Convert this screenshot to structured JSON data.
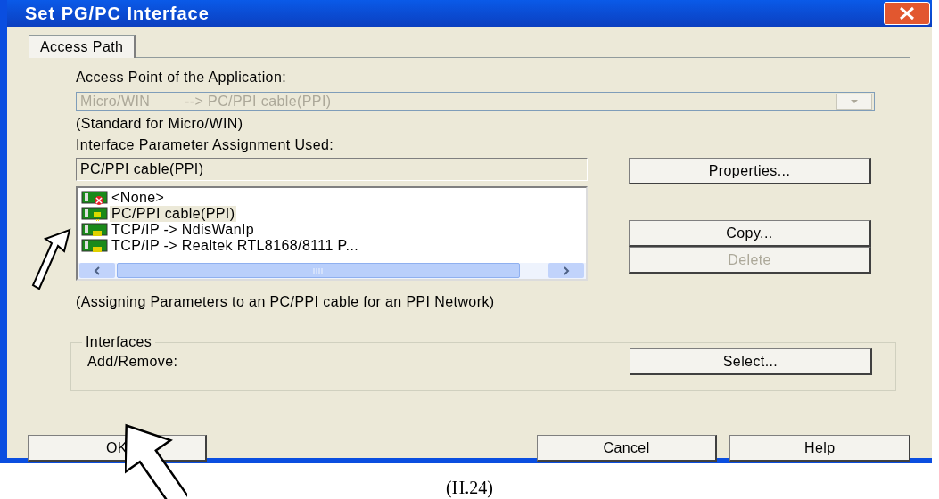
{
  "window": {
    "title": "Set PG/PC Interface"
  },
  "tabs": [
    {
      "label": "Access Path",
      "selected": true
    }
  ],
  "access_point": {
    "label": "Access Point of the Application:",
    "value": "Micro/WIN        --> PC/PPI cable(PPI)",
    "disabled": true,
    "note": "(Standard for Micro/WIN)"
  },
  "assignment": {
    "label": "Interface Parameter Assignment Used:",
    "value": "PC/PPI cable(PPI)"
  },
  "interfaces_list": [
    {
      "label": "<None>",
      "kind": "none",
      "selected": false
    },
    {
      "label": "PC/PPI cable(PPI)",
      "kind": "cable",
      "selected": true
    },
    {
      "label": "TCP/IP -> NdisWanIp",
      "kind": "network",
      "selected": false
    },
    {
      "label": "TCP/IP -> Realtek RTL8168/8111 P...",
      "kind": "network",
      "selected": false
    }
  ],
  "side_buttons": [
    {
      "label": "Properties...",
      "disabled": false
    },
    {
      "label": "Copy...",
      "disabled": false
    },
    {
      "label": "Delete",
      "disabled": true
    }
  ],
  "description": "(Assigning Parameters to an PC/PPI cable for an PPI Network)",
  "interfaces_group": {
    "title": "Interfaces",
    "label": "Add/Remove:",
    "button": "Select..."
  },
  "buttons": [
    "OK",
    "Cancel",
    "Help"
  ],
  "caption": "(H.24)"
}
